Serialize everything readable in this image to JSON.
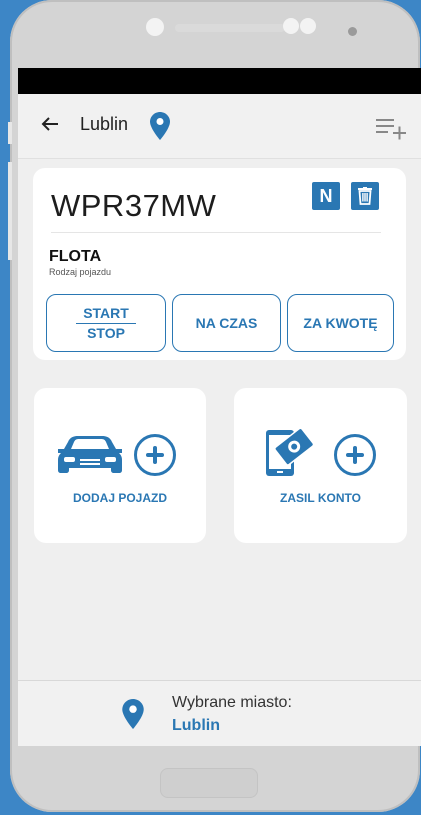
{
  "header": {
    "city": "Lublin",
    "back_icon": "arrow-left-icon",
    "location_icon": "location-pin-icon",
    "menu_icon": "filter-list-icon"
  },
  "vehicle_card": {
    "plate": "WPR37MW",
    "badge_label": "N",
    "delete_icon": "trash-icon",
    "vehicle_type": "FLOTA",
    "vehicle_type_caption": "Rodzaj pojazdu",
    "actions": {
      "start_label": "START",
      "stop_label": "STOP",
      "na_czas_label": "NA CZAS",
      "za_kwote_label": "ZA KWOTĘ"
    }
  },
  "tiles": {
    "add_vehicle_label": "DODAJ POJAZD",
    "add_vehicle_icon": "car-icon",
    "top_up_label": "ZASIL KONTO",
    "top_up_icon": "phone-payment-icon"
  },
  "footer": {
    "label": "Wybrane miasto:",
    "city": "Lublin"
  },
  "colors": {
    "accent": "#2a77b3",
    "background": "#3d86c6"
  }
}
